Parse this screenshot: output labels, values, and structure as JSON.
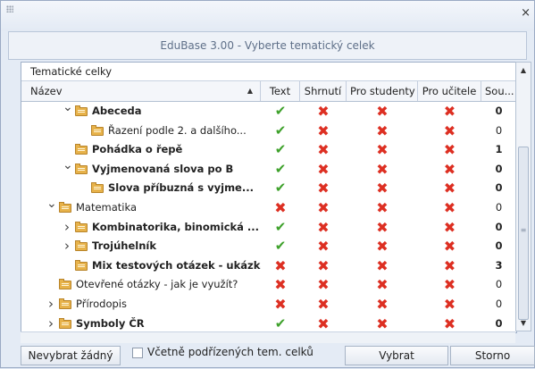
{
  "window": {
    "title": "EduBase 3.00 - Vyberte tematický celek",
    "close_glyph": "×"
  },
  "grid": {
    "group_panel_label": "Tematické celky",
    "columns": {
      "name": "Název",
      "text": "Text",
      "shrnuti": "Shrnutí",
      "pro_studenty": "Pro studenty",
      "pro_ucitele": "Pro učitele",
      "soubory": "Sou..."
    },
    "rows": [
      {
        "indent": 1,
        "expander": "collapse",
        "label": "Abeceda",
        "bold": true,
        "text": true,
        "shrnuti": false,
        "pro_studenty": false,
        "pro_ucitele": false,
        "count": "0"
      },
      {
        "indent": 2,
        "expander": "",
        "label": "Řazení podle 2. a dalšího...",
        "bold": false,
        "text": true,
        "shrnuti": false,
        "pro_studenty": false,
        "pro_ucitele": false,
        "count": "0"
      },
      {
        "indent": 1,
        "expander": "",
        "label": "Pohádka o řepě",
        "bold": true,
        "text": true,
        "shrnuti": false,
        "pro_studenty": false,
        "pro_ucitele": false,
        "count": "1"
      },
      {
        "indent": 1,
        "expander": "collapse",
        "label": "Vyjmenovaná slova po B",
        "bold": true,
        "text": true,
        "shrnuti": false,
        "pro_studenty": false,
        "pro_ucitele": false,
        "count": "0"
      },
      {
        "indent": 2,
        "expander": "",
        "label": "Slova příbuzná s vyjme...",
        "bold": true,
        "text": true,
        "shrnuti": false,
        "pro_studenty": false,
        "pro_ucitele": false,
        "count": "0"
      },
      {
        "indent": 0,
        "expander": "collapse",
        "label": "Matematika",
        "bold": false,
        "text": false,
        "shrnuti": false,
        "pro_studenty": false,
        "pro_ucitele": false,
        "count": "0"
      },
      {
        "indent": 1,
        "expander": "expand",
        "label": "Kombinatorika, binomická ...",
        "bold": true,
        "text": true,
        "shrnuti": false,
        "pro_studenty": false,
        "pro_ucitele": false,
        "count": "0"
      },
      {
        "indent": 1,
        "expander": "expand",
        "label": "Trojúhelník",
        "bold": true,
        "text": true,
        "shrnuti": false,
        "pro_studenty": false,
        "pro_ucitele": false,
        "count": "0"
      },
      {
        "indent": 1,
        "expander": "",
        "label": "Mix testových otázek - ukázka...",
        "bold": true,
        "text": false,
        "shrnuti": false,
        "pro_studenty": false,
        "pro_ucitele": false,
        "count": "3"
      },
      {
        "indent": 0,
        "expander": "",
        "label": "Otevřené otázky - jak je využít?",
        "bold": false,
        "text": false,
        "shrnuti": false,
        "pro_studenty": false,
        "pro_ucitele": false,
        "count": "0"
      },
      {
        "indent": 0,
        "expander": "expand",
        "label": "Přírodopis",
        "bold": false,
        "text": false,
        "shrnuti": false,
        "pro_studenty": false,
        "pro_ucitele": false,
        "count": "0"
      },
      {
        "indent": 0,
        "expander": "expand",
        "label": "Symboly ČR",
        "bold": true,
        "text": true,
        "shrnuti": false,
        "pro_studenty": false,
        "pro_ucitele": false,
        "count": "0"
      }
    ]
  },
  "footer": {
    "deselect_button": "Nevybrat žádný",
    "include_sub_label": "Včetně podřízených tem. celků",
    "include_sub_checked": false,
    "select_button": "Vybrat",
    "cancel_button": "Storno"
  },
  "icons": {
    "check": "check-icon",
    "cross": "cross-icon",
    "folder": "folder-icon",
    "expand": "chevron-right-icon",
    "collapse": "chevron-down-icon"
  },
  "colors": {
    "check": "#3ea12b",
    "cross": "#dd2f22",
    "folder": "#e7b24a"
  }
}
